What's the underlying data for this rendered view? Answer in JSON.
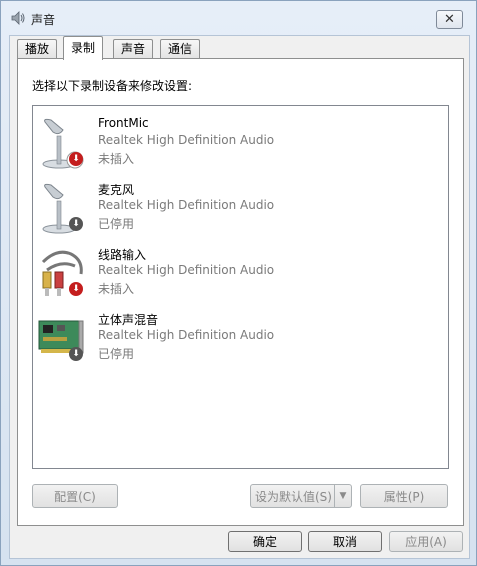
{
  "window": {
    "title": "声音",
    "close_label": "✕"
  },
  "tabs": [
    {
      "label": "播放"
    },
    {
      "label": "录制",
      "active": true
    },
    {
      "label": "声音"
    },
    {
      "label": "通信"
    }
  ],
  "panel": {
    "instruction": "选择以下录制设备来修改设置:",
    "devices": [
      {
        "name": "FrontMic",
        "driver": "Realtek High Definition Audio",
        "status": "未插入",
        "icon": "microphone-icon",
        "badge": "unplugged-red-arrow"
      },
      {
        "name": "麦克风",
        "driver": "Realtek High Definition Audio",
        "status": "已停用",
        "icon": "microphone-icon",
        "badge": "disabled-gray-arrow"
      },
      {
        "name": "线路输入",
        "driver": "Realtek High Definition Audio",
        "status": "未插入",
        "icon": "rca-cable-icon",
        "badge": "unplugged-red-arrow"
      },
      {
        "name": "立体声混音",
        "driver": "Realtek High Definition Audio",
        "status": "已停用",
        "icon": "sound-card-icon",
        "badge": "disabled-gray-arrow"
      }
    ],
    "buttons": {
      "configure": "配置(C)",
      "set_default": "设为默认值(S)",
      "properties": "属性(P)"
    }
  },
  "footer": {
    "ok": "确定",
    "cancel": "取消",
    "apply": "应用(A)"
  },
  "colors": {
    "unplugged_badge": "#c41e1e",
    "disabled_badge": "#555555",
    "secondary_text": "#7a7a7a"
  }
}
